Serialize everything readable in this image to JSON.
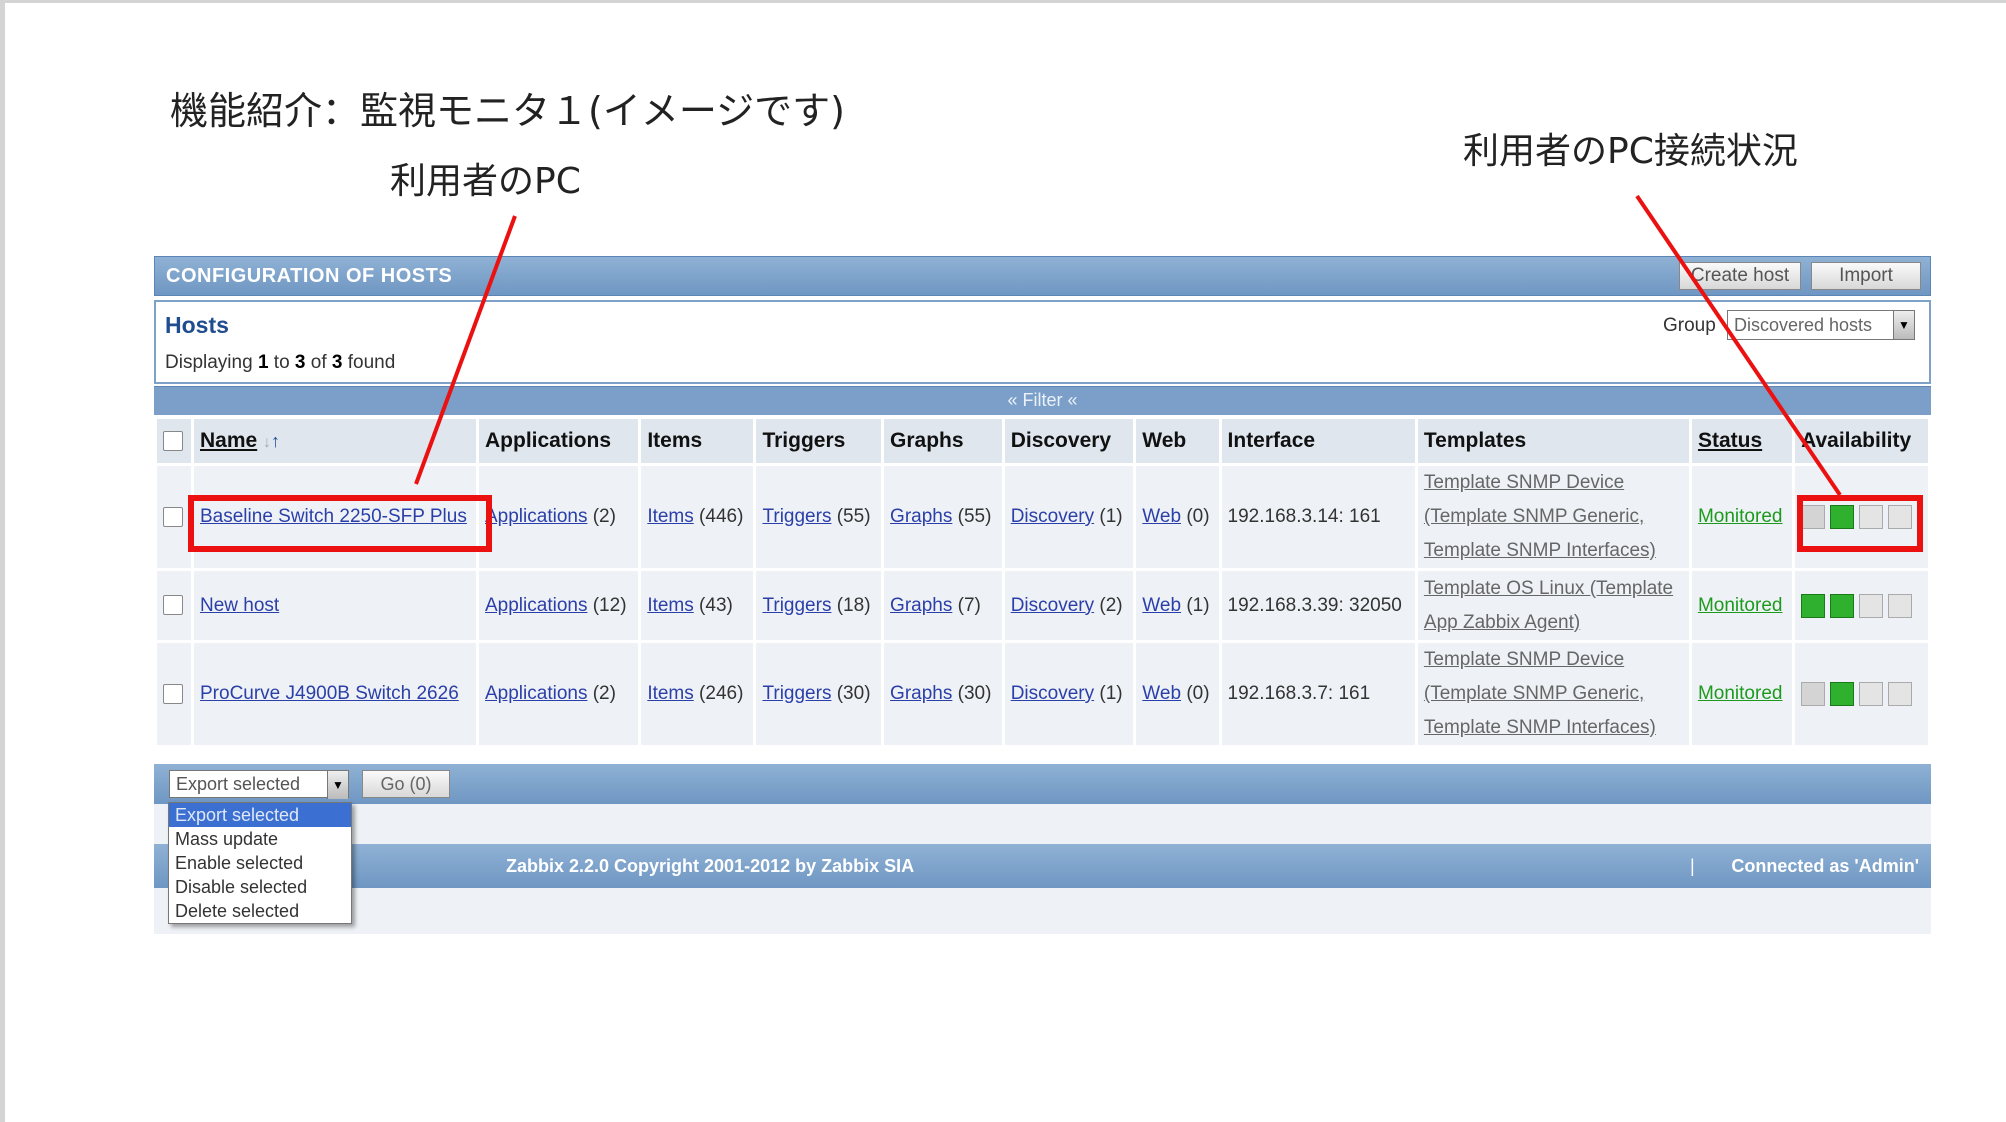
{
  "slide": {
    "title": "機能紹介：監視モニタ１(イメージです)",
    "callout_pc": "利用者のPC",
    "callout_connection": "利用者のPC接続状況"
  },
  "header": {
    "title": "CONFIGURATION OF HOSTS",
    "create_host": "Create host",
    "import": "Import"
  },
  "hosts_box": {
    "title": "Hosts",
    "displaying_prefix": "Displaying ",
    "from": "1",
    "to_word": " to ",
    "to": "3",
    "of_word": " of ",
    "total": "3",
    "found_word": " found",
    "group_label": "Group",
    "group_value": "Discovered hosts"
  },
  "filter": {
    "label": "« Filter «"
  },
  "table": {
    "columns": {
      "name": "Name",
      "applications": "Applications",
      "items": "Items",
      "triggers": "Triggers",
      "graphs": "Graphs",
      "discovery": "Discovery",
      "web": "Web",
      "interface": "Interface",
      "templates": "Templates",
      "status": "Status",
      "availability": "Availability"
    },
    "rows": [
      {
        "name": "Baseline Switch 2250-SFP Plus",
        "applications": "Applications",
        "applications_count": "(2)",
        "items": "Items",
        "items_count": "(446)",
        "triggers": "Triggers",
        "triggers_count": "(55)",
        "graphs": "Graphs",
        "graphs_count": "(55)",
        "discovery": "Discovery",
        "discovery_count": "(1)",
        "web": "Web",
        "web_count": "(0)",
        "interface": "192.168.3.14: 161",
        "template_1": "Template SNMP Device",
        "template_2": "(Template SNMP Generic,",
        "template_3": "Template SNMP Interfaces)",
        "status": "Monitored"
      },
      {
        "name": "New host",
        "applications": "Applications",
        "applications_count": "(12)",
        "items": "Items",
        "items_count": "(43)",
        "triggers": "Triggers",
        "triggers_count": "(18)",
        "graphs": "Graphs",
        "graphs_count": "(7)",
        "discovery": "Discovery",
        "discovery_count": "(2)",
        "web": "Web",
        "web_count": "(1)",
        "interface": "192.168.3.39: 32050",
        "template_1": "Template OS Linux (Template",
        "template_2": "App Zabbix Agent)",
        "status": "Monitored"
      },
      {
        "name": "ProCurve J4900B Switch 2626",
        "applications": "Applications",
        "applications_count": "(2)",
        "items": "Items",
        "items_count": "(246)",
        "triggers": "Triggers",
        "triggers_count": "(30)",
        "graphs": "Graphs",
        "graphs_count": "(30)",
        "discovery": "Discovery",
        "discovery_count": "(1)",
        "web": "Web",
        "web_count": "(0)",
        "interface": "192.168.3.7: 161",
        "template_1": "Template SNMP Device",
        "template_2": "(Template SNMP Generic,",
        "template_3": "Template SNMP Interfaces)",
        "status": "Monitored"
      }
    ]
  },
  "actions": {
    "selected": "Export selected",
    "go": "Go (0)",
    "options": [
      "Export selected",
      "Mass update",
      "Enable selected",
      "Disable selected",
      "Delete selected"
    ]
  },
  "footer": {
    "copyright": "Zabbix 2.2.0 Copyright 2001-2012 by Zabbix SIA",
    "separator": "|",
    "connected": "Connected as 'Admin'"
  },
  "colors": {
    "highlight": "#ec1111",
    "header": "#7b9fc8",
    "monitored": "#1d9a1d",
    "link": "#2b3fa8"
  }
}
